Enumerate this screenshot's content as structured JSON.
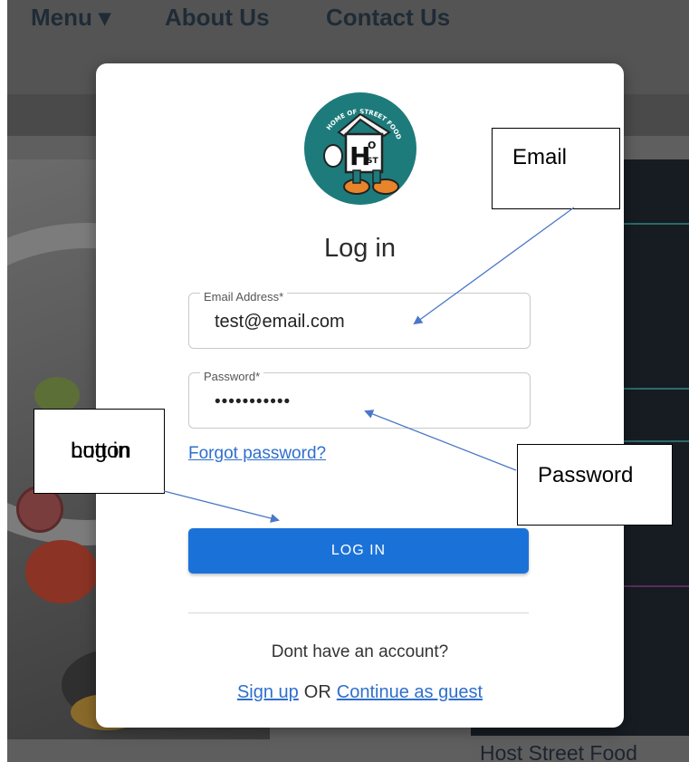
{
  "background": {
    "nav": {
      "menu": "Menu ▾",
      "about": "About Us",
      "contact": "Contact Us"
    },
    "right_card_title": "Host Street Food"
  },
  "modal": {
    "logo": {
      "arc_text": "HOME OF STREET FOOD",
      "letters": {
        "h": "H",
        "o": "O",
        "st": "ST"
      },
      "brand_color": "#1e7b7b"
    },
    "title": "Log in",
    "email": {
      "label": "Email Address",
      "required_mark": "*",
      "value": "test@email.com"
    },
    "password": {
      "label": "Password",
      "required_mark": "*",
      "masked_value": "•••••••••••"
    },
    "forgot_link": "Forgot password?",
    "login_button": "LOG IN",
    "no_account_text": "Dont have an account?",
    "signup_link": "Sign up",
    "or_text": "OR",
    "guest_link": "Continue as guest",
    "colors": {
      "primary": "#1a72d9",
      "link": "#2f6fcc"
    }
  },
  "annotations": {
    "email": "Email",
    "password": "Password",
    "login_line1": "Log in",
    "login_line2": "button",
    "arrow_color": "#4a78c8"
  }
}
